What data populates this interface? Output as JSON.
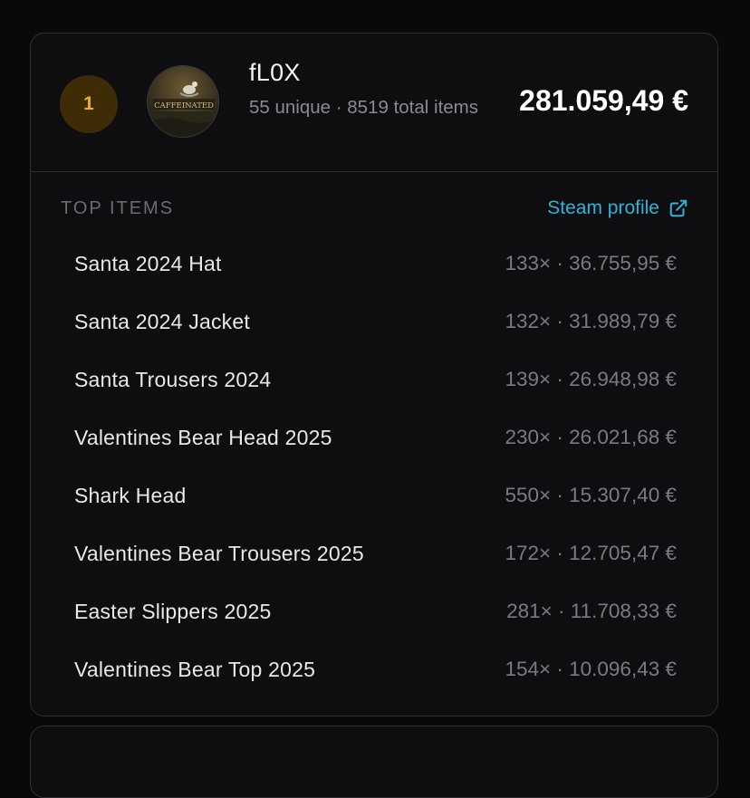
{
  "entry": {
    "rank": "1",
    "avatar_text": "CAFFEINATED",
    "username": "fL0X",
    "stats": "55 unique · 8519 total items",
    "total_value": "281.059,49 €"
  },
  "top_items": {
    "title": "TOP ITEMS",
    "steam_link_label": "Steam profile",
    "steam_link_icon": "external-link-icon",
    "items": [
      {
        "name": "Santa 2024 Hat",
        "value": "133× · 36.755,95 €"
      },
      {
        "name": "Santa 2024 Jacket",
        "value": "132× · 31.989,79 €"
      },
      {
        "name": "Santa Trousers 2024",
        "value": "139× · 26.948,98 €"
      },
      {
        "name": "Valentines Bear Head 2025",
        "value": "230× · 26.021,68 €"
      },
      {
        "name": "Shark Head",
        "value": "550× · 15.307,40 €"
      },
      {
        "name": "Valentines Bear Trousers 2025",
        "value": "172× · 12.705,47 €"
      },
      {
        "name": "Easter Slippers 2025",
        "value": "281× · 11.708,33 €"
      },
      {
        "name": "Valentines Bear Top 2025",
        "value": "154× · 10.096,43 €"
      }
    ]
  },
  "colors": {
    "background": "#09090b",
    "card": "#0e0e11",
    "border": "#2e2e33",
    "rank_badge_bg": "#3d2c06",
    "rank_badge_text": "#f2b01e",
    "link": "#2bb5d8",
    "muted_text": "#7a7a82"
  }
}
